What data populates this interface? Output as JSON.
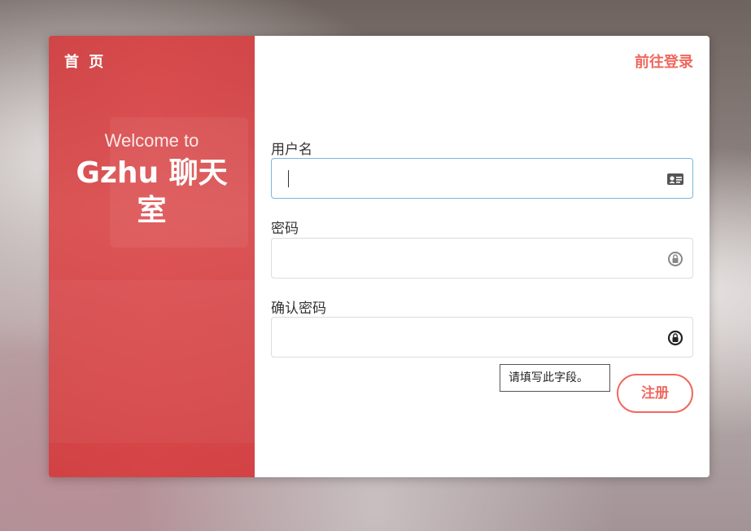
{
  "left": {
    "home_label": "首 页",
    "welcome_text": "Welcome to",
    "room_title": "Gzhu 聊天室"
  },
  "right": {
    "login_link": "前往登录",
    "username": {
      "label": "用户名",
      "value": "",
      "icon": "id-card-icon"
    },
    "password": {
      "label": "密码",
      "value": "",
      "icon": "lock-icon"
    },
    "confirm_password": {
      "label": "确认密码",
      "value": "",
      "icon": "lock-icon"
    },
    "validation_tooltip": "请填写此字段。",
    "register_button": "注册"
  },
  "colors": {
    "accent": "#f0685e",
    "left_panel": "#d94a4c",
    "focus_border": "#7ab8dc"
  }
}
